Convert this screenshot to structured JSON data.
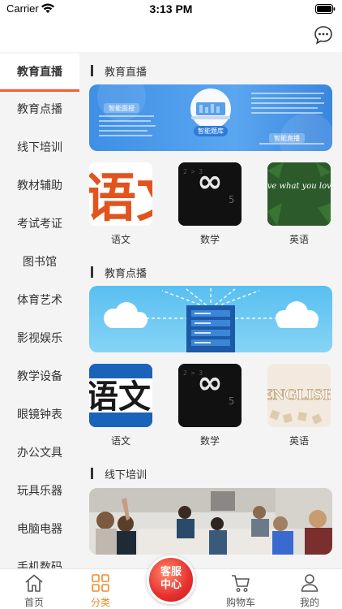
{
  "status": {
    "carrier": "Carrier",
    "time": "3:13 PM"
  },
  "sidebar": {
    "items": [
      {
        "label": "教育直播",
        "active": true
      },
      {
        "label": "教育点播"
      },
      {
        "label": "线下培训"
      },
      {
        "label": "教材辅助"
      },
      {
        "label": "考试考证"
      },
      {
        "label": "图书馆"
      },
      {
        "label": "体育艺术"
      },
      {
        "label": "影视娱乐"
      },
      {
        "label": "教学设备"
      },
      {
        "label": "眼镜钟表"
      },
      {
        "label": "办公文具"
      },
      {
        "label": "玩具乐器"
      },
      {
        "label": "电脑电器"
      },
      {
        "label": "手机数码"
      }
    ]
  },
  "content": {
    "sections": [
      {
        "title": "教育直播",
        "banner_labels": [
          "智能面授",
          "智能题库",
          "智能直播"
        ],
        "subjects": [
          {
            "label": "语文",
            "art": "语文"
          },
          {
            "label": "数学",
            "art": "∞"
          },
          {
            "label": "英语",
            "art": "live what you love"
          }
        ]
      },
      {
        "title": "教育点播",
        "subjects": [
          {
            "label": "语文",
            "art": "语文"
          },
          {
            "label": "数学",
            "art": "∞"
          },
          {
            "label": "英语",
            "art": "ENGLISH"
          }
        ]
      },
      {
        "title": "线下培训"
      }
    ]
  },
  "bottom_nav": {
    "items": [
      {
        "label": "首页",
        "icon": "home-icon"
      },
      {
        "label": "分类",
        "icon": "category-icon",
        "active": true
      },
      {
        "label": "购物车",
        "icon": "cart-icon"
      },
      {
        "label": "我的",
        "icon": "user-icon"
      }
    ],
    "service": "客服中心"
  },
  "colors": {
    "accent": "#ff5a2c",
    "nav_active": "#f08a2a",
    "service": "#e62f2f"
  }
}
